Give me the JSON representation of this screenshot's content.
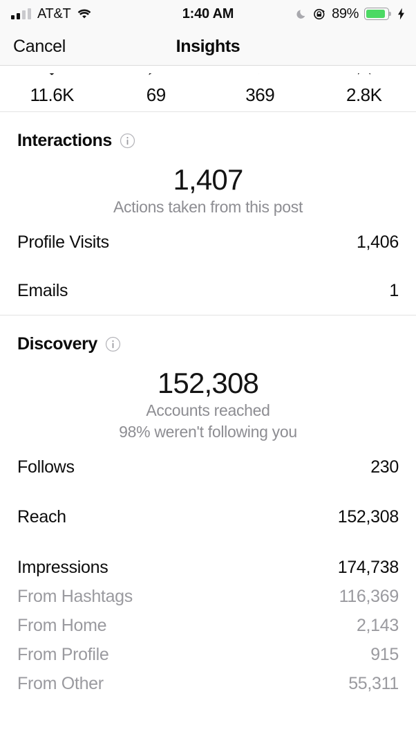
{
  "status_bar": {
    "carrier": "AT&T",
    "signal_bars_filled": 2,
    "signal_bars_total": 4,
    "wifi_icon": "wifi-icon",
    "time": "1:40 AM",
    "do_not_disturb_icon": "moon-icon",
    "rotation_lock_icon": "rotation-lock-icon",
    "battery_percent": "89%",
    "battery_level": 89,
    "battery_color": "#4cd964",
    "charging_icon": "lightning-bolt-icon"
  },
  "nav": {
    "cancel_label": "Cancel",
    "title": "Insights"
  },
  "post_stats": [
    {
      "icon": "heart-icon",
      "value": "11.6K"
    },
    {
      "icon": "comment-icon",
      "value": "69"
    },
    {
      "icon": "share-icon",
      "value": "369"
    },
    {
      "icon": "bookmark-icon",
      "value": "2.8K"
    }
  ],
  "interactions": {
    "title": "Interactions",
    "info_icon": "info-icon",
    "summary_value": "1,407",
    "summary_sub": "Actions taken from this post",
    "rows": [
      {
        "label": "Profile Visits",
        "value": "1,406"
      },
      {
        "label": "Emails",
        "value": "1"
      }
    ]
  },
  "discovery": {
    "title": "Discovery",
    "info_icon": "info-icon",
    "summary_value": "152,308",
    "summary_sub_1": "Accounts reached",
    "summary_sub_2": "98% weren't following you",
    "rows": [
      {
        "label": "Follows",
        "value": "230"
      },
      {
        "label": "Reach",
        "value": "152,308"
      }
    ],
    "impressions": {
      "label": "Impressions",
      "value": "174,738"
    },
    "impressions_breakdown": [
      {
        "label": "From Hashtags",
        "value": "116,369"
      },
      {
        "label": "From Home",
        "value": "2,143"
      },
      {
        "label": "From Profile",
        "value": "915"
      },
      {
        "label": "From Other",
        "value": "55,311"
      }
    ]
  },
  "colors": {
    "text_primary": "#0c0c0c",
    "text_secondary": "#8d8d92",
    "divider": "#e3e3e3",
    "chrome_background": "#f9f9f9",
    "battery_green": "#4cd964"
  }
}
